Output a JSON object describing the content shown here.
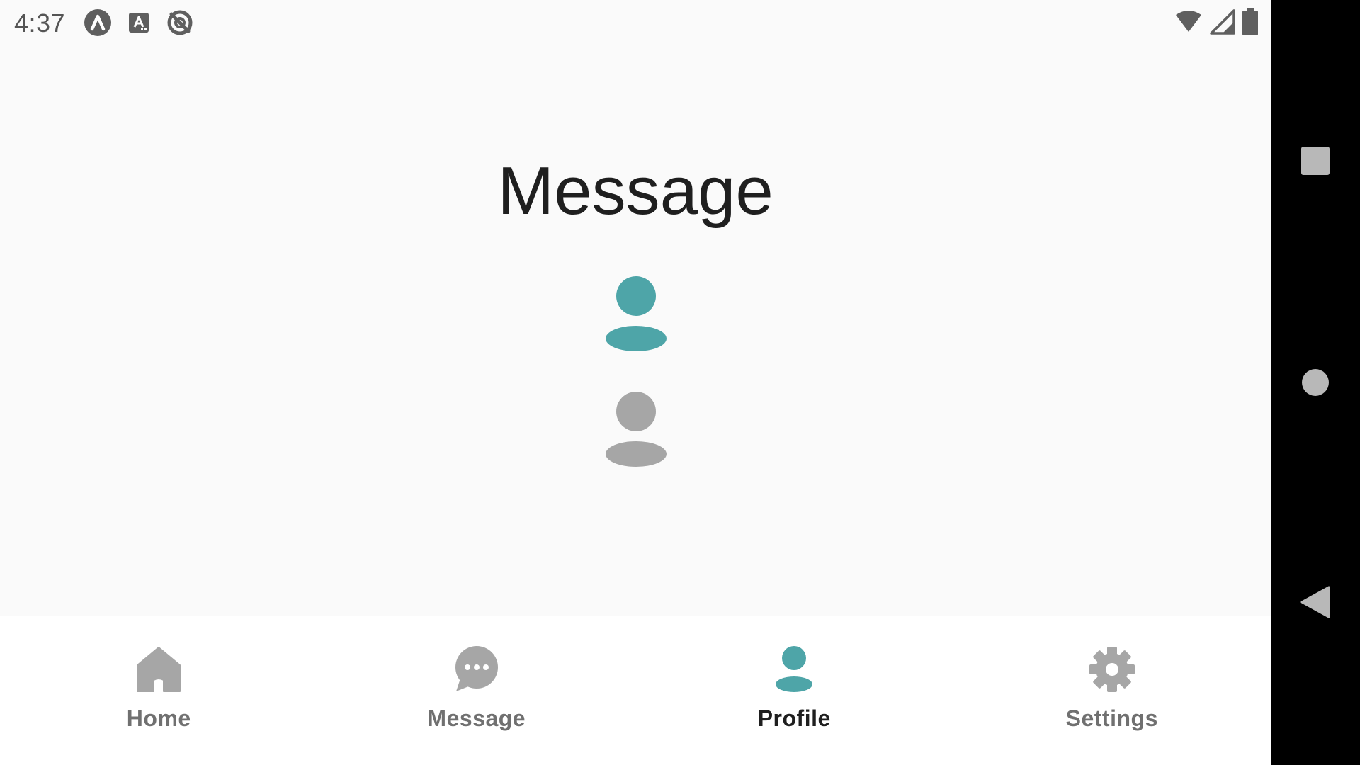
{
  "status_bar": {
    "time": "4:37",
    "left_icons": [
      "app-logo-icon",
      "keyboard-a-icon",
      "no-sync-icon"
    ],
    "right_icons": [
      "wifi-icon",
      "cellular-signal-icon",
      "battery-icon"
    ]
  },
  "main": {
    "title": "Message",
    "avatars": [
      {
        "icon": "person-icon",
        "color": "#4ea5a8"
      },
      {
        "icon": "person-icon",
        "color": "#a6a6a6"
      }
    ]
  },
  "bottom_nav": {
    "items": [
      {
        "label": "Home",
        "icon": "home-icon",
        "active": false
      },
      {
        "label": "Message",
        "icon": "chat-bubble-icon",
        "active": false
      },
      {
        "label": "Profile",
        "icon": "person-icon",
        "active": true
      },
      {
        "label": "Settings",
        "icon": "gear-icon",
        "active": false
      }
    ]
  },
  "system_nav": {
    "buttons": [
      "recent-apps-icon",
      "home-circle-icon",
      "back-triangle-icon"
    ]
  },
  "colors": {
    "accent": "#4ea5a8",
    "inactive_icon": "#a6a6a6",
    "background": "#fafafa",
    "nav_background": "#ffffff",
    "system_bar": "#000000"
  }
}
